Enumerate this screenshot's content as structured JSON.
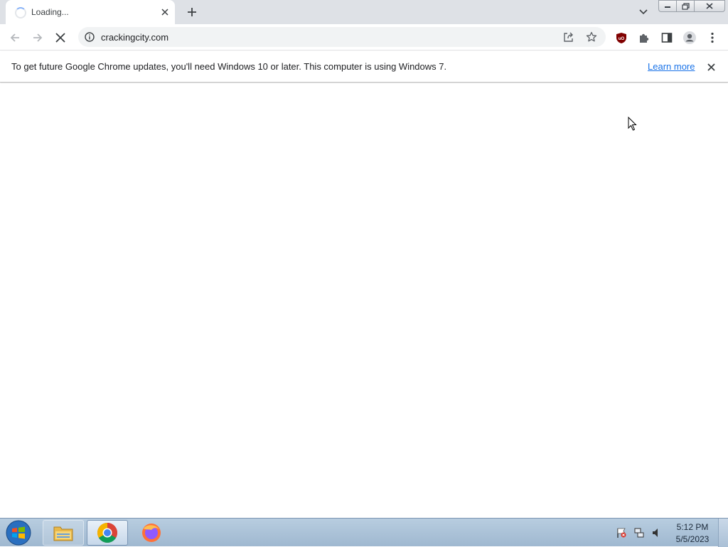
{
  "browser": {
    "tab": {
      "title": "Loading..."
    },
    "omnibox": {
      "url": "crackingcity.com"
    },
    "infobar": {
      "message": "To get future Google Chrome updates, you'll need Windows 10 or later. This computer is using Windows 7.",
      "link": "Learn more"
    },
    "icons": {
      "back": "back-arrow-icon",
      "forward": "forward-arrow-icon",
      "stop": "stop-icon",
      "site_info": "info-icon",
      "share": "share-icon",
      "bookmark": "star-icon",
      "ublock": "ublock-origin-icon",
      "extensions": "puzzle-piece-icon",
      "side_panel": "side-panel-icon",
      "profile": "profile-icon",
      "menu": "three-dots-icon"
    },
    "colors": {
      "tabstrip": "#dee1e6",
      "omnibox": "#f1f3f4",
      "link": "#1a73e8",
      "ublock": "#800000"
    }
  },
  "taskbar": {
    "apps": [
      "start-orb",
      "windows-explorer",
      "google-chrome",
      "firefox"
    ],
    "clock": {
      "time": "5:12 PM",
      "date": "5/5/2023"
    }
  }
}
